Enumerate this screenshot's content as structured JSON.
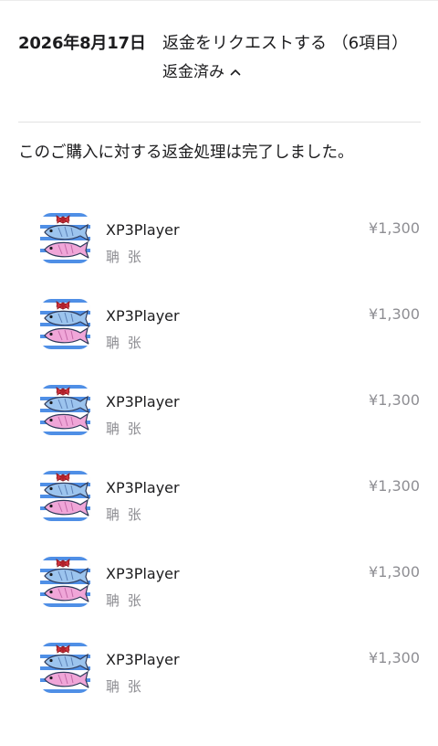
{
  "header": {
    "date": "2026年8月17日",
    "title": "返金をリクエストする （6項目）",
    "status": "返金済み",
    "status_icon": "chevron-up-icon"
  },
  "message": "このご購入に対する返金処理は完了しました。",
  "items": [
    {
      "name": "XP3Player",
      "developer": "聃 张",
      "price": "¥1,300",
      "icon": "fish-app-icon"
    },
    {
      "name": "XP3Player",
      "developer": "聃 张",
      "price": "¥1,300",
      "icon": "fish-app-icon"
    },
    {
      "name": "XP3Player",
      "developer": "聃 张",
      "price": "¥1,300",
      "icon": "fish-app-icon"
    },
    {
      "name": "XP3Player",
      "developer": "聃 张",
      "price": "¥1,300",
      "icon": "fish-app-icon"
    },
    {
      "name": "XP3Player",
      "developer": "聃 张",
      "price": "¥1,300",
      "icon": "fish-app-icon"
    },
    {
      "name": "XP3Player",
      "developer": "聃 张",
      "price": "¥1,300",
      "icon": "fish-app-icon"
    }
  ],
  "colors": {
    "text": "#1c1c1e",
    "secondary": "#8e8e93",
    "icon_stripe": "#4f8fe6",
    "fish_blue": "#9cc4ee",
    "fish_pink": "#f0a6d8",
    "bow_red": "#d0303a"
  }
}
